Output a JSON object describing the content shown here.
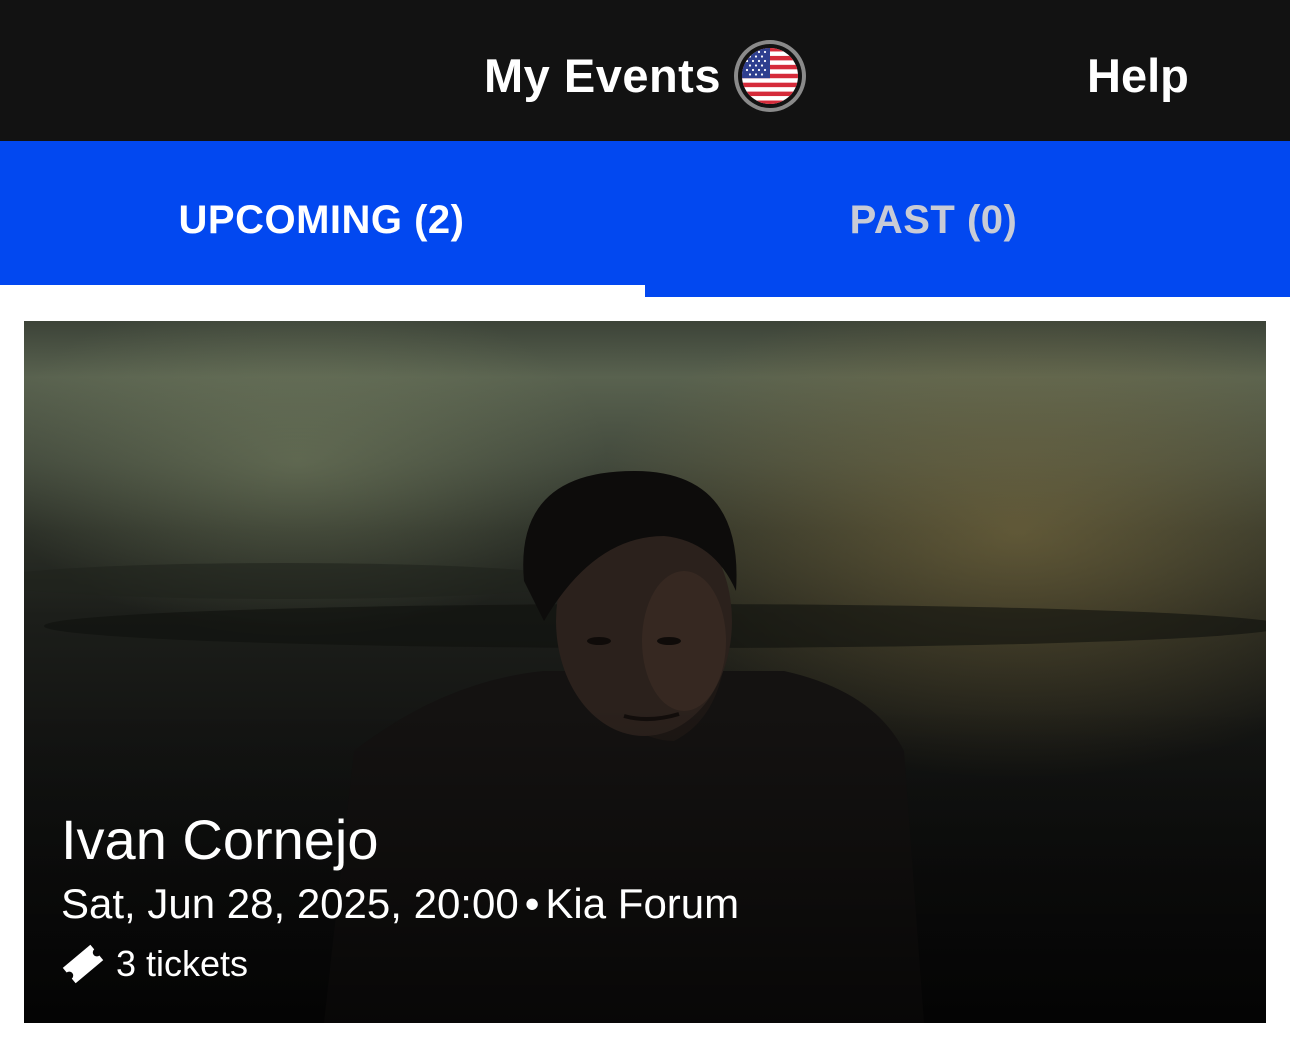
{
  "header": {
    "title": "My Events",
    "region_icon": "us-flag-icon",
    "help_label": "Help"
  },
  "tabs": [
    {
      "label": "UPCOMING (2)",
      "active": true
    },
    {
      "label": "PAST (0)",
      "active": false
    }
  ],
  "events": [
    {
      "name": "Ivan Cornejo",
      "date": "Sat, Jun 28, 2025, 20:00",
      "separator": "•",
      "venue": "Kia Forum",
      "ticket_icon": "ticket-icon",
      "tickets": "3 tickets"
    }
  ],
  "colors": {
    "topbar_bg": "#121212",
    "tab_bar_bg": "#0248f0",
    "active_tab_text": "#ffffff",
    "inactive_tab_text": "#c8cbd6"
  }
}
